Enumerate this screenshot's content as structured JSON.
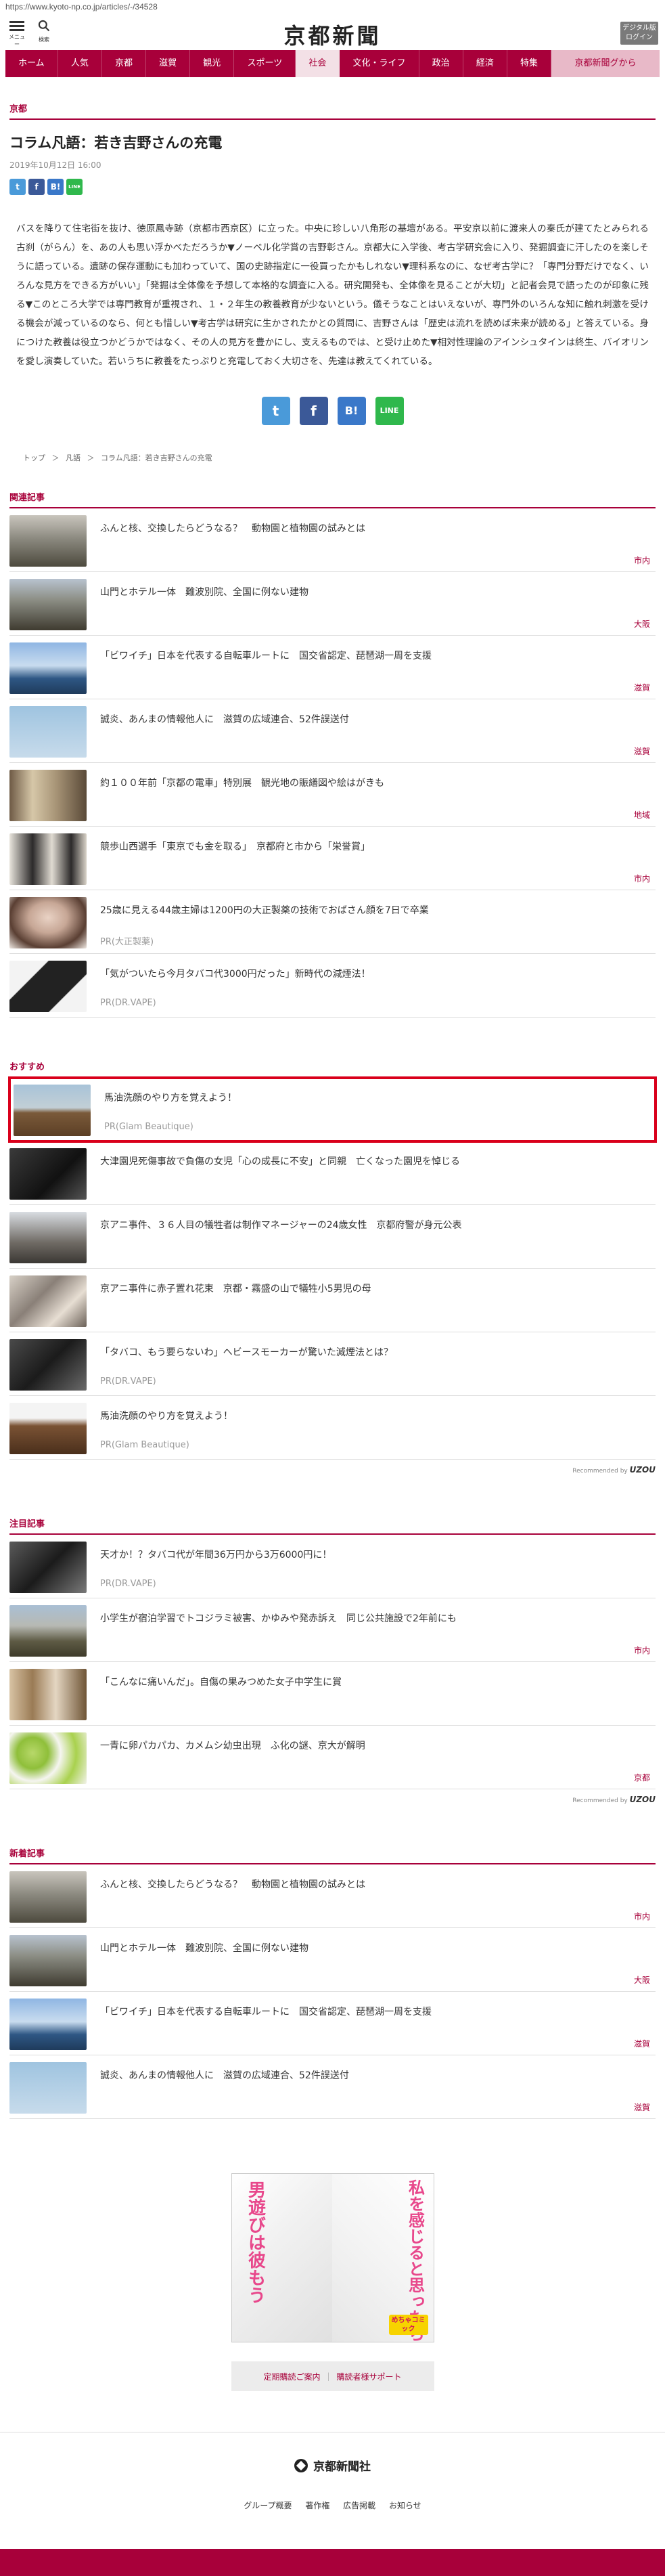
{
  "browser": {
    "url": "https://www.kyoto-np.co.jp/articles/-/34528"
  },
  "header": {
    "menu_label": "メニュー",
    "search_label": "検索",
    "logo": "京都新聞",
    "digital_line1": "デジタル版",
    "digital_line2": "ログイン"
  },
  "nav": {
    "items": [
      "ホーム",
      "人気",
      "京都",
      "滋賀",
      "観光",
      "スポーツ",
      "社会",
      "文化・ライフ",
      "政治",
      "経済",
      "特集"
    ],
    "last": "京都新聞グから"
  },
  "article": {
    "category": "京都",
    "title": "コラム凡語：若き吉野さんの充電",
    "date": "2019年10月12日 16:00",
    "body": "バスを降りて住宅街を抜け、徳原鳳寺跡（京都市西京区）に立った。中央に珍しい八角形の基壇がある。平安京以前に渡来人の秦氏が建てたとみられる古刹（がらん）を、あの人も思い浮かべただろうか▼ノーベル化学賞の吉野彰さん。京都大に入学後、考古学研究会に入り、発掘調査に汗したのを楽しそうに語っている。遺跡の保存運動にも加わっていて、国の史跡指定に一役買ったかもしれない▼理科系なのに、なぜ考古学に？「専門分野だけでなく、いろんな見方をできる方がいい」「発掘は全体像を予想して本格的な調査に入る。研究開発も、全体像を見ることが大切」と記者会見で語ったのが印象に残る▼このところ大学では専門教育が重視され、１・２年生の教養教育が少ないという。儀そうなことはいえないが、専門外のいろんな知に触れ刺激を受ける機会が減っているのなら、何とも惜しい▼考古学は研究に生かされたかとの質問に、吉野さんは「歴史は流れを読めば未来が読める」と答えている。身につけた教養は役立つかどうかではなく、その人の見方を豊かにし、支えるものでは、と受け止めた▼相対性理論のアインシュタインは終生、バイオリンを愛し演奏していた。若いうちに教養をたっぷりと充電しておく大切さを、先達は教えてくれている。"
  },
  "share": {
    "twitter": "t",
    "facebook": "f",
    "hatena": "B!",
    "line": "LINE"
  },
  "breadcrumb": [
    "トップ",
    "＞",
    "凡語",
    "＞",
    "コラム凡語：若き吉野さんの充電"
  ],
  "sections": {
    "related": {
      "label": "関連記事",
      "items": [
        {
          "title": "ふんと核、交換したらどうなる？　動物園と植物園の試みとは",
          "region": "市内"
        },
        {
          "title": "山門とホテル一体　難波別院、全国に例ない建物",
          "region": "大阪"
        },
        {
          "title": "「ビワイチ」日本を代表する自転車ルートに　国交省認定、琵琶湖一周を支援",
          "region": "滋賀"
        },
        {
          "title": "誠炎、あんまの情報他人に　滋賀の広域連合、52件誤送付",
          "region": "滋賀"
        },
        {
          "title": "約１００年前「京都の電車」特別展　観光地の賑繕図や絵はがきも",
          "region": "地域"
        },
        {
          "title": "競歩山西選手「東京でも金を取る」　京都府と市から「栄誉賞」",
          "region": "市内"
        },
        {
          "title": "25歳に見える44歳主婦は1200円の大正製薬の技術でおばさん顔を7日で卒業",
          "pr": "PR(大正製薬)"
        },
        {
          "title": "「気がついたら今月タバコ代3000円だった」新時代の減煙法！",
          "pr": "PR(DR.VAPE)"
        }
      ]
    },
    "recommend": {
      "label": "おすすめ",
      "items": [
        {
          "title": "馬油洗顔のやり方を覚えよう！",
          "pr": "PR(Glam Beautique)"
        },
        {
          "title": "大津園児死傷事故で負傷の女児「心の成長に不安」と同親　亡くなった園児を悼じる"
        },
        {
          "title": "京アニ事件、３６人目の犠牲者は制作マネージャーの24歳女性　京都府警が身元公表"
        },
        {
          "title": "京アニ事件に赤子置れ花束　京都・霧盛の山で犠牲小5男児の母"
        },
        {
          "title": "「タバコ、もう要らないわ」ヘビースモーカーが驚いた減煙法とは？",
          "pr": "PR(DR.VAPE)"
        },
        {
          "title": "馬油洗顔のやり方を覚えよう！",
          "pr": "PR(Glam Beautique)"
        }
      ],
      "recommended_by": "Recommended by",
      "brand": "UZOU"
    },
    "featured": {
      "label": "注目記事",
      "items": [
        {
          "title": "天才か！？タバコ代が年間36万円から3万6000円に！",
          "pr": "PR(DR.VAPE)"
        },
        {
          "title": "小学生が宿泊学習でトコジラミ被害、かゆみや発赤訴え　同じ公共施設で2年前にも",
          "region": "市内"
        },
        {
          "title": "「こんなに痛いんだ」。自傷の果みつめた女子中学生に賞",
          "region": ""
        },
        {
          "title": "一青に卵パカパカ、カメムシ幼虫出現　ふ化の謎、京大が解明",
          "region": "京都"
        }
      ],
      "recommended_by": "Recommended by",
      "brand": "UZOU"
    },
    "latest": {
      "label": "新着記事",
      "items": [
        {
          "title": "ふんと核、交換したらどうなる？　動物園と植物園の試みとは",
          "region": "市内"
        },
        {
          "title": "山門とホテル一体　難波別院、全国に例ない建物",
          "region": "大阪"
        },
        {
          "title": "「ビワイチ」日本を代表する自転車ルートに　国交省認定、琵琶湖一周を支援",
          "region": "滋賀"
        },
        {
          "title": "誠炎、あんまの情報他人に　滋賀の広域連合、52件誤送付",
          "region": "滋賀"
        }
      ]
    }
  },
  "ad": {
    "left_text": "男遊びは彼もう",
    "right_text": "私を感じると思ったら",
    "badge": "めちゃコミック"
  },
  "footer_links": [
    "定期購読ご案内",
    "購読者様サポート"
  ],
  "footer": {
    "logo": "京都新聞社",
    "nav": [
      "グループ概要",
      "著作権",
      "広告掲載",
      "お知らせ"
    ]
  },
  "colors": {
    "accent": "#a8003a",
    "highlight_border": "#d9001b"
  }
}
